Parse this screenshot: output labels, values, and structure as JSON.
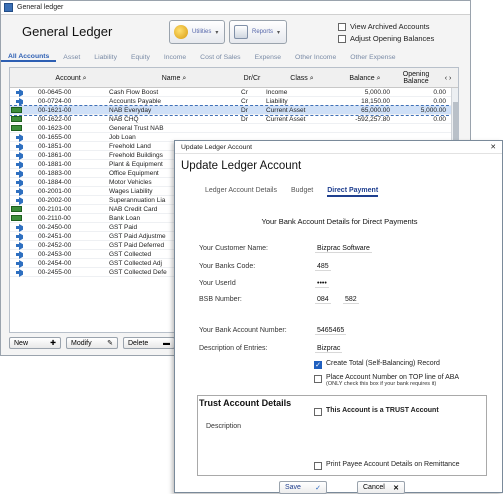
{
  "gl": {
    "window_title": "General ledger",
    "heading": "General Ledger",
    "utilities_label": "Utilities",
    "reports_label": "Reports",
    "view_archived_label": "View Archived Accounts",
    "adjust_opening_label": "Adjust Opening Balances",
    "tabs": [
      "All Accounts",
      "Asset",
      "Liability",
      "Equity",
      "Income",
      "Cost of Sales",
      "Expense",
      "Other Income",
      "Other Expense"
    ],
    "columns": {
      "account": "Account",
      "name": "Name",
      "drcr": "Dr/Cr",
      "class": "Class",
      "balance": "Balance",
      "opening": "Opening Balance"
    },
    "rows": [
      {
        "account": "00-0645-00",
        "name": "Cash Flow Boost",
        "drcr": "Cr",
        "class": "Income",
        "balance": "5,000.00",
        "opening": "0.00",
        "icon": "arrow",
        "selected": false
      },
      {
        "account": "00-0724-00",
        "name": "Accounts Payable",
        "drcr": "Cr",
        "class": "Liability",
        "balance": "18,150.00",
        "opening": "0.00",
        "icon": "arrow",
        "selected": false
      },
      {
        "account": "00-1621-00",
        "name": "NAB Everyday",
        "drcr": "Dr",
        "class": "Current Asset",
        "balance": "65,000.00",
        "opening": "5,000.00",
        "icon": "money",
        "selected": true
      },
      {
        "account": "00-1622-00",
        "name": "NAB CHQ",
        "drcr": "Dr",
        "class": "Current Asset",
        "balance": "-592,257.80",
        "opening": "0.00",
        "icon": "money",
        "selected": false
      },
      {
        "account": "00-1623-00",
        "name": "General Trust NAB",
        "drcr": "",
        "class": "",
        "balance": "",
        "opening": "",
        "icon": "money",
        "selected": false
      },
      {
        "account": "00-1655-00",
        "name": "Job Loan",
        "drcr": "",
        "class": "",
        "balance": "",
        "opening": "",
        "icon": "arrow",
        "selected": false
      },
      {
        "account": "00-1851-00",
        "name": "Freehold Land",
        "drcr": "",
        "class": "",
        "balance": "",
        "opening": "",
        "icon": "arrow",
        "selected": false
      },
      {
        "account": "00-1861-00",
        "name": "Freehold Buildings",
        "drcr": "",
        "class": "",
        "balance": "",
        "opening": "",
        "icon": "arrow",
        "selected": false
      },
      {
        "account": "00-1881-00",
        "name": "Plant & Equipment",
        "drcr": "",
        "class": "",
        "balance": "",
        "opening": "",
        "icon": "arrow",
        "selected": false
      },
      {
        "account": "00-1883-00",
        "name": "Office Equipment",
        "drcr": "",
        "class": "",
        "balance": "",
        "opening": "",
        "icon": "arrow",
        "selected": false
      },
      {
        "account": "00-1884-00",
        "name": "Motor Vehicles",
        "drcr": "",
        "class": "",
        "balance": "",
        "opening": "",
        "icon": "arrow",
        "selected": false
      },
      {
        "account": "00-2001-00",
        "name": "Wages Liability",
        "drcr": "",
        "class": "",
        "balance": "",
        "opening": "",
        "icon": "arrow",
        "selected": false
      },
      {
        "account": "00-2002-00",
        "name": "Superannuation Lia",
        "drcr": "",
        "class": "",
        "balance": "",
        "opening": "",
        "icon": "arrow",
        "selected": false
      },
      {
        "account": "00-2101-00",
        "name": "NAB Credit Card",
        "drcr": "",
        "class": "",
        "balance": "",
        "opening": "",
        "icon": "money",
        "selected": false
      },
      {
        "account": "00-2110-00",
        "name": "Bank Loan",
        "drcr": "",
        "class": "",
        "balance": "",
        "opening": "",
        "icon": "money",
        "selected": false
      },
      {
        "account": "00-2450-00",
        "name": "GST Paid",
        "drcr": "",
        "class": "",
        "balance": "",
        "opening": "",
        "icon": "arrow",
        "selected": false
      },
      {
        "account": "00-2451-00",
        "name": "GST Paid Adjustme",
        "drcr": "",
        "class": "",
        "balance": "",
        "opening": "",
        "icon": "arrow",
        "selected": false
      },
      {
        "account": "00-2452-00",
        "name": "GST Paid Deferred",
        "drcr": "",
        "class": "",
        "balance": "",
        "opening": "",
        "icon": "arrow",
        "selected": false
      },
      {
        "account": "00-2453-00",
        "name": "GST Collected",
        "drcr": "",
        "class": "",
        "balance": "",
        "opening": "",
        "icon": "arrow",
        "selected": false
      },
      {
        "account": "00-2454-00",
        "name": "GST Collected Adj",
        "drcr": "",
        "class": "",
        "balance": "",
        "opening": "",
        "icon": "arrow",
        "selected": false
      },
      {
        "account": "00-2455-00",
        "name": "GST Collected Defe",
        "drcr": "",
        "class": "",
        "balance": "",
        "opening": "",
        "icon": "arrow",
        "selected": false
      }
    ],
    "buttons": {
      "new": "New",
      "modify": "Modify",
      "delete": "Delete"
    }
  },
  "dialog": {
    "window_title": "Update Ledger Account",
    "heading": "Update Ledger Account",
    "tabs": [
      "Ledger Account Details",
      "Budget",
      "Direct Payment"
    ],
    "section_title": "Your Bank Account Details for Direct Payments",
    "fields": {
      "customer_name_label": "Your Customer Name:",
      "customer_name_value": "Bizprac Software",
      "banks_code_label": "Your Banks Code:",
      "banks_code_value": "485",
      "userid_label": "Your UserId",
      "userid_value": "••••",
      "bsb_label": "BSB Number:",
      "bsb_value_1": "084",
      "bsb_value_2": "582",
      "bank_account_label": "Your Bank Account Number:",
      "bank_account_value": "5465465",
      "description_label": "Description of Entries:",
      "description_value": "Bizprac"
    },
    "create_total_label": "Create Total (Self-Balancing) Record",
    "create_total_checked": true,
    "place_account_label": "Place Account Number on TOP line of ABA",
    "place_account_sub": "(ONLY check this box if your bank requires it)",
    "place_account_checked": false,
    "trust_title": "Trust Account Details",
    "trust_check_label": "This Account is a TRUST Account",
    "trust_checked": false,
    "trust_description_label": "Description",
    "print_payee_label": "Print Payee Account Details on Remittance",
    "print_payee_checked": false,
    "save_label": "Save",
    "cancel_label": "Cancel"
  }
}
